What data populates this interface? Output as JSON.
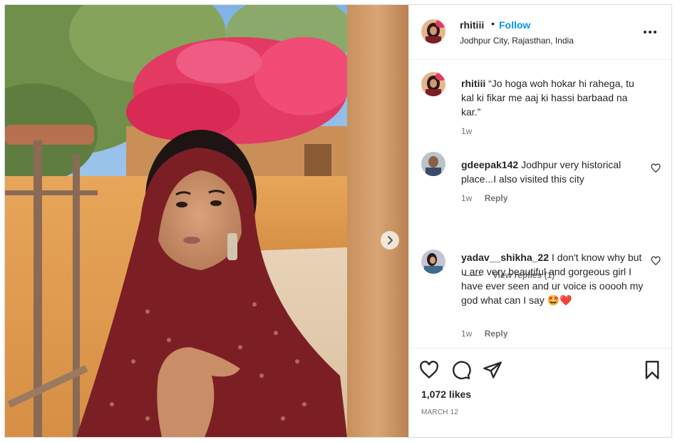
{
  "post": {
    "image_alt": "",
    "next_icon": "chevron-right-icon"
  },
  "header": {
    "username": "rhitiii",
    "separator": "•",
    "follow_label": "Follow",
    "location": "Jodhpur City, Rajasthan, India",
    "more_icon": "more-options-icon"
  },
  "comments": [
    {
      "username": "rhitiii",
      "text": "“Jo hoga woh hokar hi rahega, tu kal ki fikar me aaj ki hassi barbaad na kar.”",
      "time": "1w",
      "reply_label": ""
    },
    {
      "username": "gdeepak142",
      "text": "Jodhpur very historical place...I also visited this city",
      "time": "1w",
      "reply_label": "Reply"
    },
    {
      "username": "yadav__shikha_22",
      "text": "I don't know why but u are very beautiful and gorgeous girl I have ever seen and ur voice is ooooh my god what can I say",
      "emoji": "🤩❤️",
      "time": "1w",
      "reply_label": "Reply"
    }
  ],
  "view_replies": "View replies (1)",
  "actions": {
    "like_icon": "heart-icon",
    "comment_icon": "comment-icon",
    "share_icon": "send-icon",
    "save_icon": "bookmark-icon",
    "likes": "1,072 likes",
    "date": "MARCH 12"
  },
  "colors": {
    "accent": "#0095f6",
    "text": "#262626",
    "muted": "#737373",
    "border": "#dbdbdb"
  }
}
